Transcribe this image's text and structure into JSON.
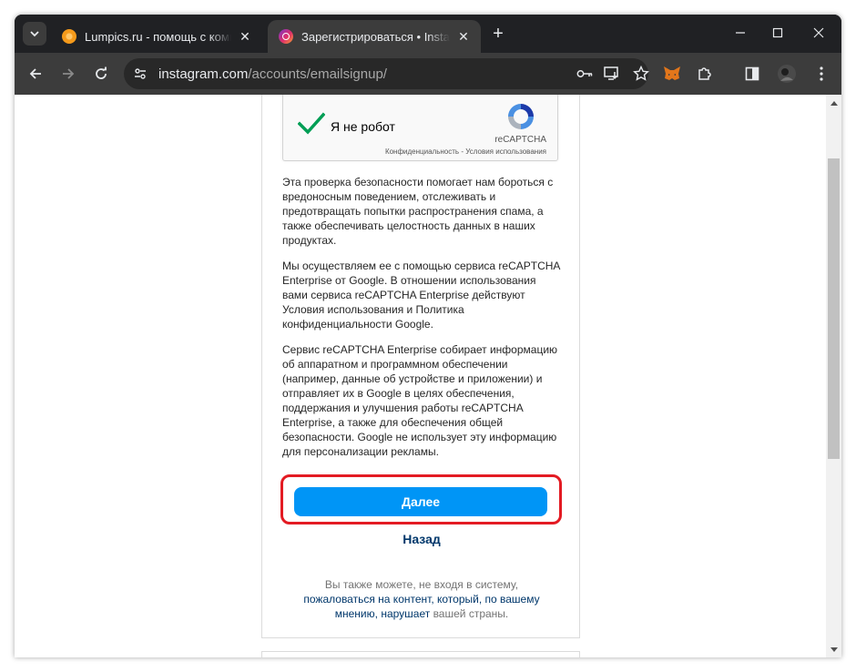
{
  "browser": {
    "tabs": [
      {
        "title": "Lumpics.ru - помощь с компьютером",
        "favicon": "lumpics-favicon",
        "active": false
      },
      {
        "title": "Зарегистрироваться • Instagram",
        "favicon": "instagram-favicon",
        "active": true
      }
    ],
    "url_host": "instagram.com",
    "url_path": "/accounts/emailsignup/",
    "icons": {
      "tab_search": "chevron-down-icon",
      "close": "close-icon",
      "new_tab": "plus-icon",
      "back": "back-arrow-icon",
      "forward": "forward-arrow-icon",
      "reload": "reload-icon",
      "site_info": "tune-icon",
      "password": "key-icon",
      "install": "install-app-icon",
      "bookmark": "star-icon",
      "extension_metamask": "metamask-icon",
      "extensions": "puzzle-icon",
      "sidebar": "side-panel-icon",
      "profile": "avatar",
      "menu": "kebab-menu-icon"
    }
  },
  "recaptcha": {
    "label": "Я не робот",
    "brand": "reCAPTCHA",
    "privacy": "Конфиденциальность",
    "separator": " - ",
    "terms": "Условия использования",
    "checked": true
  },
  "info": {
    "paragraph1": "Эта проверка безопасности помогает нам бороться с вредоносным поведением, отслеживать и предотвращать попытки распространения спама, а также обеспечивать целостность данных в наших продуктах.",
    "paragraph2": "Мы осуществляем ее с помощью сервиса reCAPTCHA Enterprise от Google. В отношении использования вами сервиса reCAPTCHA Enterprise действуют Условия использования и Политика конфиденциальности Google.",
    "paragraph3": "Сервис reCAPTCHA Enterprise собирает информацию об аппаратном и программном обеспечении (например, данные об устройстве и приложении) и отправляет их в Google в целях обеспечения, поддержания и улучшения работы reCAPTCHA Enterprise, а также для обеспечения общей безопасности. Google не использует эту информацию для персонализации рекламы."
  },
  "actions": {
    "next_label": "Далее",
    "back_label": "Назад"
  },
  "footer": {
    "prefix": "Вы также можете, не входя в систему,",
    "link1": "пожаловаться на контент, который, по вашему мнению,",
    "link2": "нарушает",
    "suffix": " вашей страны."
  },
  "colors": {
    "primary_button": "#0095f6",
    "link": "#00376b",
    "highlight": "#e31b23",
    "browser_chrome": "#202124"
  }
}
